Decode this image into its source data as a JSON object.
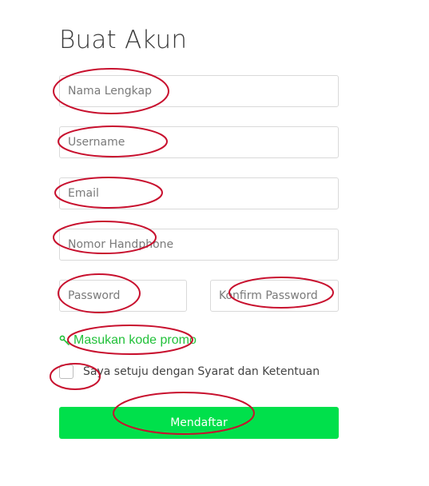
{
  "title": "Buat Akun",
  "form": {
    "full_name_placeholder": "Nama Lengkap",
    "username_placeholder": "Username",
    "email_placeholder": "Email",
    "phone_placeholder": "Nomor Handphone",
    "password_placeholder": "Password",
    "confirm_password_placeholder": "Konfirm Password",
    "promo_link": "Masukan kode promo",
    "promo_icon": "key-icon",
    "agree_label": "Saya setuju dengan Syarat dan Ketentuan",
    "agree_checked": false,
    "submit_label": "Mendaftar"
  },
  "colors": {
    "accent_green": "#00e04b",
    "link_green": "#22c13a",
    "annotation_red": "#c8102e"
  }
}
